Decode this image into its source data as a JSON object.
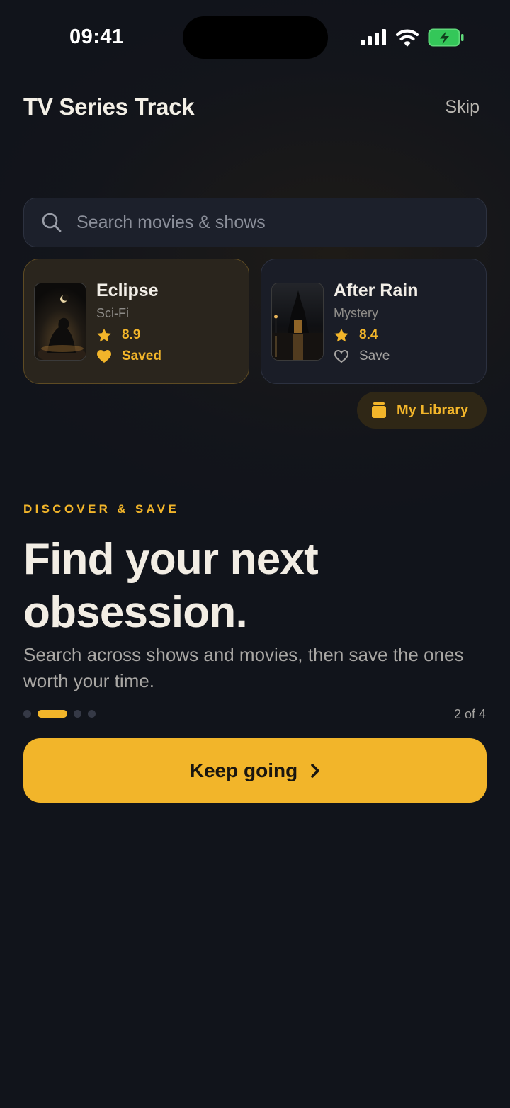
{
  "status_bar": {
    "time": "09:41"
  },
  "header": {
    "title": "TV Series Track",
    "skip_label": "Skip"
  },
  "search": {
    "placeholder": "Search movies & shows"
  },
  "cards": [
    {
      "title": "Eclipse",
      "genre": "Sci-Fi",
      "rating": "8.9",
      "save_label": "Saved",
      "saved": true
    },
    {
      "title": "After Rain",
      "genre": "Mystery",
      "rating": "8.4",
      "save_label": "Save",
      "saved": false
    }
  ],
  "library_button": {
    "label": "My Library"
  },
  "onboarding": {
    "eyebrow": "DISCOVER & SAVE",
    "headline": "Find your next obsession.",
    "subtext": "Search across shows and movies, then save the ones worth your time.",
    "page_indicator": "2 of 4",
    "current_page": 2,
    "total_pages": 4
  },
  "cta": {
    "label": "Keep going"
  },
  "colors": {
    "accent": "#f2b52a",
    "background": "#11141b",
    "card_surface": "#1a1d27"
  },
  "icons": [
    "signal-icon",
    "wifi-icon",
    "battery-charging-icon",
    "search-icon",
    "star-icon",
    "heart-filled-icon",
    "heart-outline-icon",
    "library-icon",
    "chevron-right-icon"
  ]
}
